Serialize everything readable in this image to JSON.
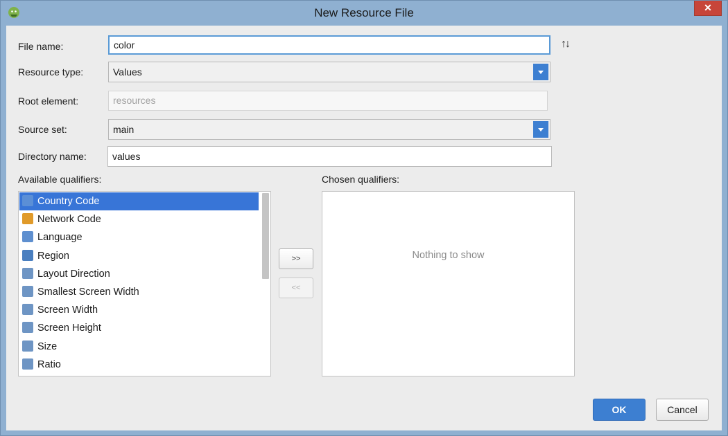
{
  "window": {
    "title": "New Resource File",
    "close_glyph": "✕"
  },
  "form": {
    "file_name_label": "File name:",
    "file_name_value": "color",
    "resource_type_label": "Resource type:",
    "resource_type_value": "Values",
    "root_element_label": "Root element:",
    "root_element_placeholder": "resources",
    "source_set_label": "Source set:",
    "source_set_value": "main",
    "directory_name_label": "Directory name:",
    "directory_name_value": "values",
    "sort_glyph": "↑↓"
  },
  "available": {
    "label": "Available qualifiers:",
    "items": [
      {
        "label": "Country Code",
        "icon": "country-code-icon",
        "color": "#5b8fd6"
      },
      {
        "label": "Network Code",
        "icon": "network-code-icon",
        "color": "#e09a2a"
      },
      {
        "label": "Language",
        "icon": "language-icon",
        "color": "#5e8fcf"
      },
      {
        "label": "Region",
        "icon": "region-icon",
        "color": "#4a7fc0"
      },
      {
        "label": "Layout Direction",
        "icon": "layout-direction-icon",
        "color": "#6e95c4"
      },
      {
        "label": "Smallest Screen Width",
        "icon": "smallest-screen-width-icon",
        "color": "#6e95c4"
      },
      {
        "label": "Screen Width",
        "icon": "screen-width-icon",
        "color": "#6e95c4"
      },
      {
        "label": "Screen Height",
        "icon": "screen-height-icon",
        "color": "#6e95c4"
      },
      {
        "label": "Size",
        "icon": "size-icon",
        "color": "#6e95c4"
      },
      {
        "label": "Ratio",
        "icon": "ratio-icon",
        "color": "#6e95c4"
      }
    ],
    "selected_index": 0
  },
  "chosen": {
    "label": "Chosen qualifiers:",
    "empty_text": "Nothing to show"
  },
  "transfer": {
    "add_label": ">>",
    "remove_label": "<<"
  },
  "buttons": {
    "ok_label": "OK",
    "cancel_label": "Cancel"
  }
}
